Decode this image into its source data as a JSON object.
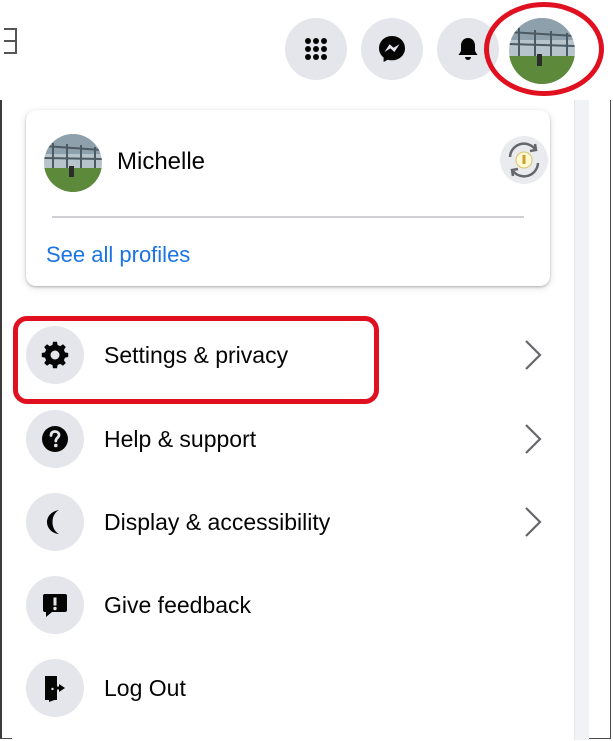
{
  "topbar": {
    "icons": [
      "menu-grid-icon",
      "messenger-icon",
      "notifications-bell-icon"
    ],
    "avatar": "profile-avatar"
  },
  "profile_card": {
    "name": "Michelle",
    "switch_icon": "switch-profile-icon",
    "see_all_label": "See all profiles"
  },
  "menu": {
    "items": [
      {
        "label": "Settings & privacy",
        "icon": "gear-icon",
        "has_chevron": true
      },
      {
        "label": "Help & support",
        "icon": "question-icon",
        "has_chevron": true
      },
      {
        "label": "Display & accessibility",
        "icon": "moon-icon",
        "has_chevron": true
      },
      {
        "label": "Give feedback",
        "icon": "feedback-icon",
        "has_chevron": false
      },
      {
        "label": "Log Out",
        "icon": "logout-icon",
        "has_chevron": false
      }
    ]
  },
  "colors": {
    "highlight": "#e01020",
    "link": "#1b74e4",
    "icon_bg": "#e4e6eb"
  }
}
